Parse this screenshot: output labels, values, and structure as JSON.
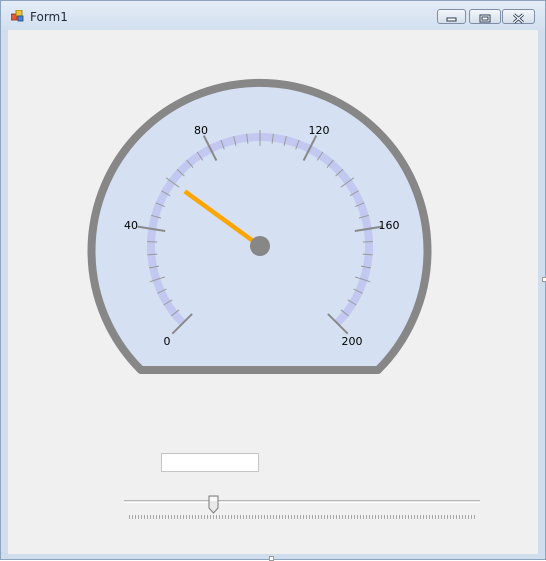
{
  "window": {
    "title": "Form1",
    "buttons": {
      "minimize": "minimize",
      "maximize": "maximize",
      "close": "close"
    }
  },
  "gauge": {
    "labels": [
      "0",
      "40",
      "80",
      "120",
      "160",
      "200"
    ],
    "min": 0,
    "max": 200,
    "needle_value": 60,
    "colors": {
      "bezel": "#878787",
      "face": "#d5e0f3",
      "scale_band": "#c2c8f0",
      "needle": "#ffa500",
      "hub": "#878787"
    }
  },
  "textbox": {
    "value": ""
  },
  "slider": {
    "value_fraction": 0.25
  }
}
